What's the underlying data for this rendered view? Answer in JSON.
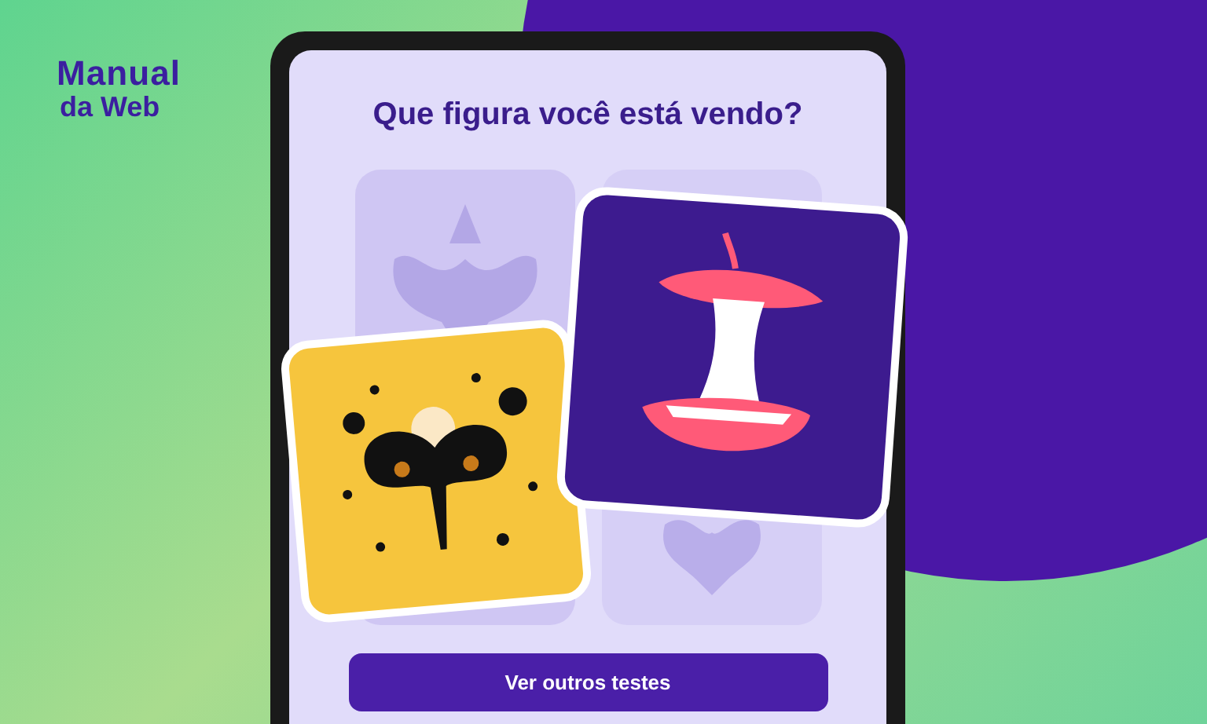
{
  "logo": {
    "line_1": "Manual",
    "line_2": "da Web"
  },
  "screen": {
    "title": "Que figura você está vendo?",
    "button": "Ver outros testes"
  }
}
